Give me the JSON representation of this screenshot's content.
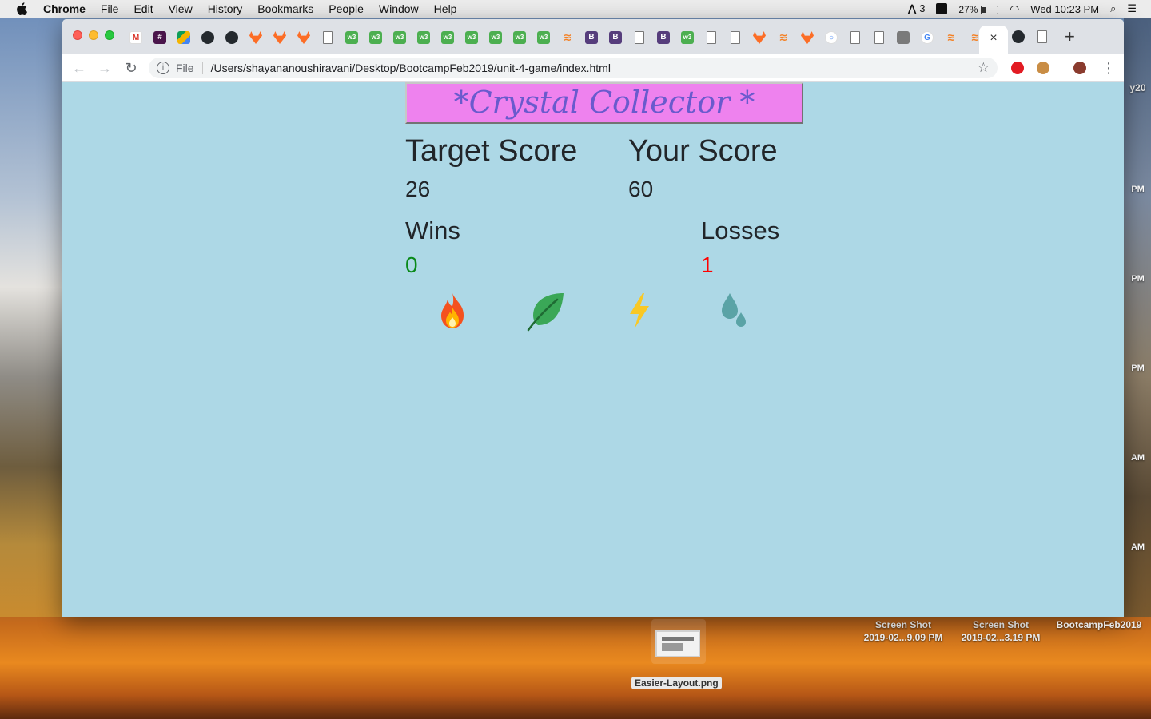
{
  "menubar": {
    "app": "Chrome",
    "items": [
      "File",
      "Edit",
      "View",
      "History",
      "Bookmarks",
      "People",
      "Window",
      "Help"
    ],
    "status": {
      "adobe_count": "3",
      "battery": "27%",
      "clock": "Wed 10:23 PM"
    }
  },
  "browser": {
    "scheme": "File",
    "url": "/Users/shayananoushiravani/Desktop/BootcampFeb2019/unit-4-game/index.html",
    "active_tab_close": "×",
    "new_tab": "+"
  },
  "game": {
    "title": "*Crystal Collector *",
    "target_label": "Target Score",
    "target_value": "26",
    "your_label": "Your Score",
    "your_value": "60",
    "wins_label": "Wins",
    "wins_value": "0",
    "losses_label": "Losses",
    "losses_value": "1",
    "crystals": [
      "fire-icon",
      "leaf-icon",
      "lightning-icon",
      "water-drops-icon"
    ]
  },
  "desktop": {
    "right_edge_text": "y20",
    "clock_labels": [
      "PM",
      "PM",
      "PM",
      "AM",
      "AM"
    ],
    "files": [
      {
        "line1": "Screen Shot",
        "line2": "2019-02...9.09 PM"
      },
      {
        "line1": "Screen Shot",
        "line2": "2019-02...3.19 PM"
      },
      {
        "line1": "BootcampFeb2019",
        "line2": ""
      }
    ],
    "selected_file": "Easier-Layout.png"
  },
  "colors": {
    "page_bg": "#add8e6",
    "banner_bg": "#ee82ee",
    "banner_text": "#6a5acd",
    "wins_color": "#0a8a1a",
    "losses_color": "#ff0000"
  }
}
